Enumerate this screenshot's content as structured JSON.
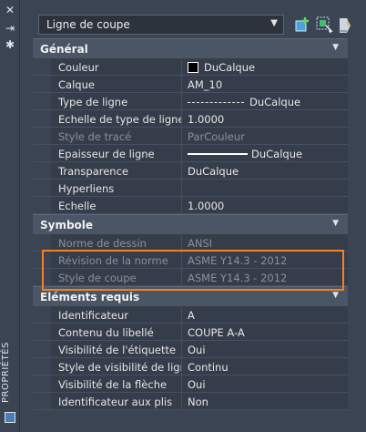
{
  "side_title": "PROPRIÉTÉS",
  "toolbar": {
    "object_type": "Ligne de coupe"
  },
  "sections": {
    "general": {
      "title": "Général",
      "rows": [
        {
          "label": "Couleur",
          "value": "DuCalque"
        },
        {
          "label": "Calque",
          "value": "AM_10"
        },
        {
          "label": "Type de ligne",
          "value": "DuCalque"
        },
        {
          "label": "Echelle de type de ligne",
          "value": "1.0000"
        },
        {
          "label": "Style de tracé",
          "value": "ParCouleur"
        },
        {
          "label": "Epaisseur de ligne",
          "value": "DuCalque"
        },
        {
          "label": "Transparence",
          "value": "DuCalque"
        },
        {
          "label": "Hyperliens",
          "value": ""
        },
        {
          "label": "Echelle",
          "value": "1.0000"
        }
      ]
    },
    "symbole": {
      "title": "Symbole",
      "rows": [
        {
          "label": "Norme de dessin",
          "value": "ANSI"
        },
        {
          "label": "Révision de la norme",
          "value": "ASME Y14.3 - 2012"
        },
        {
          "label": "Style de coupe",
          "value": "ASME Y14.3 - 2012"
        }
      ]
    },
    "elements": {
      "title": "Eléments requis",
      "rows": [
        {
          "label": "Identificateur",
          "value": "A"
        },
        {
          "label": "Contenu du libellé",
          "value": "COUPE A-A"
        },
        {
          "label": "Visibilité de l'étiquette",
          "value": "Oui"
        },
        {
          "label": "Style de visibilité de ligne",
          "value": "Continu"
        },
        {
          "label": "Visibilité de la flèche",
          "value": "Oui"
        },
        {
          "label": "Identificateur aux plis",
          "value": "Non"
        }
      ]
    }
  },
  "colors": {
    "highlight": "#f5821f",
    "background": "#3b4453"
  }
}
